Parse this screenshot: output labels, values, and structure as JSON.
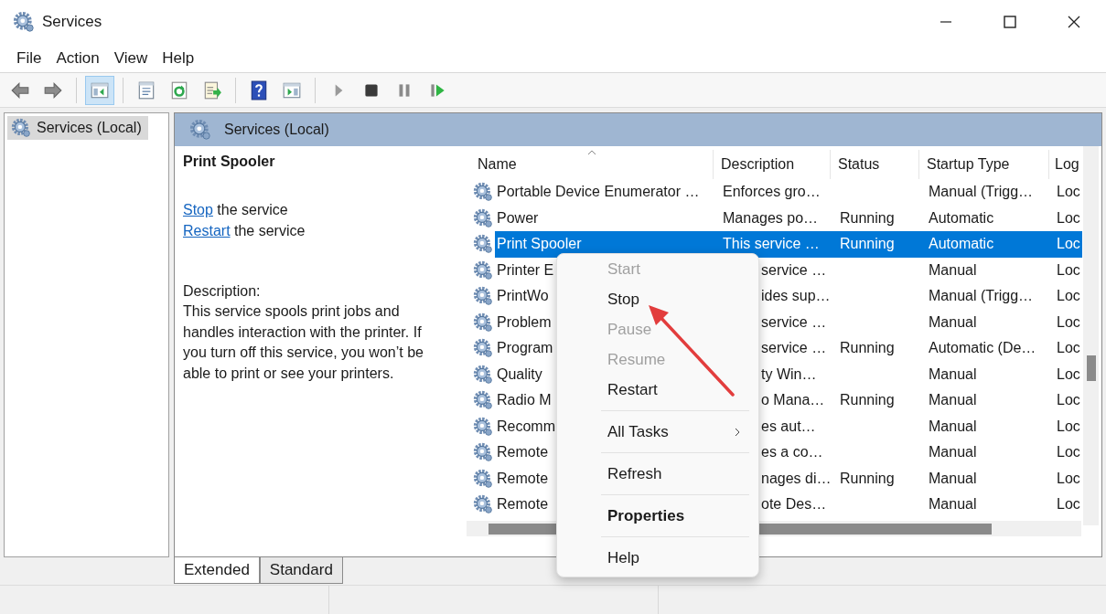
{
  "window": {
    "title": "Services"
  },
  "menu_bar": [
    "File",
    "Action",
    "View",
    "Help"
  ],
  "toolbar_groups": [
    [
      {
        "kind": "back",
        "selected": false
      },
      {
        "kind": "forward",
        "selected": false
      }
    ],
    [
      {
        "kind": "console-tree",
        "selected": true
      }
    ],
    [
      {
        "kind": "properties",
        "selected": false
      },
      {
        "kind": "refresh",
        "selected": false
      },
      {
        "kind": "export",
        "selected": false
      }
    ],
    [
      {
        "kind": "help",
        "selected": false
      },
      {
        "kind": "action-pane",
        "selected": false
      }
    ],
    [
      {
        "kind": "start",
        "selected": false
      },
      {
        "kind": "stop",
        "selected": false
      },
      {
        "kind": "pause",
        "selected": false
      },
      {
        "kind": "resume",
        "selected": false
      }
    ]
  ],
  "tree": {
    "items": [
      {
        "label": "Services (Local)",
        "selected": true
      }
    ]
  },
  "pane_header": {
    "title": "Services (Local)"
  },
  "detail": {
    "title": "Print Spooler",
    "actions": [
      {
        "link": "Stop",
        "text": "the service"
      },
      {
        "link": "Restart",
        "text": "the service"
      }
    ],
    "description_label": "Description:",
    "description": "This service spools print jobs and handles interaction with the printer. If you turn off this service, you won’t be able to print or see your printers."
  },
  "table": {
    "columns": [
      {
        "label": "Name",
        "sorted": true
      },
      {
        "label": "Description",
        "sorted": false
      },
      {
        "label": "Status",
        "sorted": false
      },
      {
        "label": "Startup Type",
        "sorted": false
      },
      {
        "label": "Log",
        "sorted": false
      }
    ],
    "rows": [
      {
        "name": "Portable Device Enumerator …",
        "description": "Enforces gro…",
        "status": "",
        "startup_type": "Manual (Trigg…",
        "log_on": "Loc",
        "selected": false
      },
      {
        "name": "Power",
        "description": "Manages po…",
        "status": "Running",
        "startup_type": "Automatic",
        "log_on": "Loc",
        "selected": false
      },
      {
        "name": "Print Spooler",
        "description": "This service …",
        "status": "Running",
        "startup_type": "Automatic",
        "log_on": "Loc",
        "selected": true
      },
      {
        "name": "Printer E",
        "description": "service …",
        "status": "",
        "startup_type": "Manual",
        "log_on": "Loc",
        "selected": false
      },
      {
        "name": "PrintWo",
        "description": "ides sup…",
        "status": "",
        "startup_type": "Manual (Trigg…",
        "log_on": "Loc",
        "selected": false
      },
      {
        "name": "Problem",
        "description": "service …",
        "status": "",
        "startup_type": "Manual",
        "log_on": "Loc",
        "selected": false
      },
      {
        "name": "Program",
        "description": "service …",
        "status": "Running",
        "startup_type": "Automatic (De…",
        "log_on": "Loc",
        "selected": false
      },
      {
        "name": "Quality",
        "description": "ty Win…",
        "status": "",
        "startup_type": "Manual",
        "log_on": "Loc",
        "selected": false
      },
      {
        "name": "Radio M",
        "description": "o Mana…",
        "status": "Running",
        "startup_type": "Manual",
        "log_on": "Loc",
        "selected": false
      },
      {
        "name": "Recomm",
        "description": "es aut…",
        "status": "",
        "startup_type": "Manual",
        "log_on": "Loc",
        "selected": false
      },
      {
        "name": "Remote",
        "description": "es a co…",
        "status": "",
        "startup_type": "Manual",
        "log_on": "Loc",
        "selected": false
      },
      {
        "name": "Remote",
        "description": "nages di…",
        "status": "Running",
        "startup_type": "Manual",
        "log_on": "Loc",
        "selected": false
      },
      {
        "name": "Remote",
        "description": "ote Des…",
        "status": "",
        "startup_type": "Manual",
        "log_on": "Loc",
        "selected": false
      }
    ]
  },
  "context_menu": [
    {
      "kind": "item",
      "label": "Start",
      "disabled": true
    },
    {
      "kind": "item",
      "label": "Stop",
      "disabled": false
    },
    {
      "kind": "item",
      "label": "Pause",
      "disabled": true
    },
    {
      "kind": "item",
      "label": "Resume",
      "disabled": true
    },
    {
      "kind": "item",
      "label": "Restart",
      "disabled": false
    },
    {
      "kind": "separator"
    },
    {
      "kind": "submenu",
      "label": "All Tasks",
      "disabled": false
    },
    {
      "kind": "separator"
    },
    {
      "kind": "item",
      "label": "Refresh",
      "disabled": false
    },
    {
      "kind": "separator"
    },
    {
      "kind": "default",
      "label": "Properties",
      "disabled": false
    },
    {
      "kind": "separator"
    },
    {
      "kind": "item",
      "label": "Help",
      "disabled": false
    }
  ],
  "view_tabs": [
    {
      "label": "Extended",
      "selected": true
    },
    {
      "label": "Standard",
      "selected": false
    }
  ]
}
